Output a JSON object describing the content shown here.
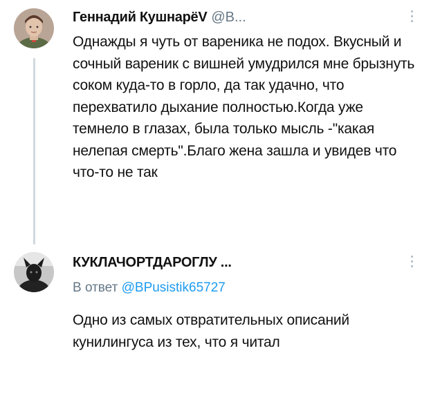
{
  "tweet1": {
    "display_name": "Геннадий КушнарёV",
    "handle": "@В...",
    "text": "Однажды я чуть от вареника не подох. Вкусный и сочный вареник с вишней умудрился мне брызнуть соком куда-то в горло, да так удачно, что перехватило дыхание полностью.Когда уже темнело в глазах, была только мысль -\"какая нелепая смерть\".Благо жена зашла и увидев что что-то не так",
    "avatar_icon": "profile-photo-boy-in-uniform"
  },
  "tweet2": {
    "display_name": "КУКЛАЧОРТДАРОГЛУ ...",
    "reply_prefix": "В ответ",
    "reply_mention": "@BPusistik65727",
    "text": "Одно из самых отвратительных описаний кунилингуса из тех, что я читал",
    "avatar_icon": "profile-photo-dark-figure"
  },
  "icons": {
    "more": "more-vertical-icon"
  },
  "colors": {
    "handle_gray": "#657786",
    "link_blue": "#1d9bf0",
    "thread_line": "#cfd9de"
  }
}
